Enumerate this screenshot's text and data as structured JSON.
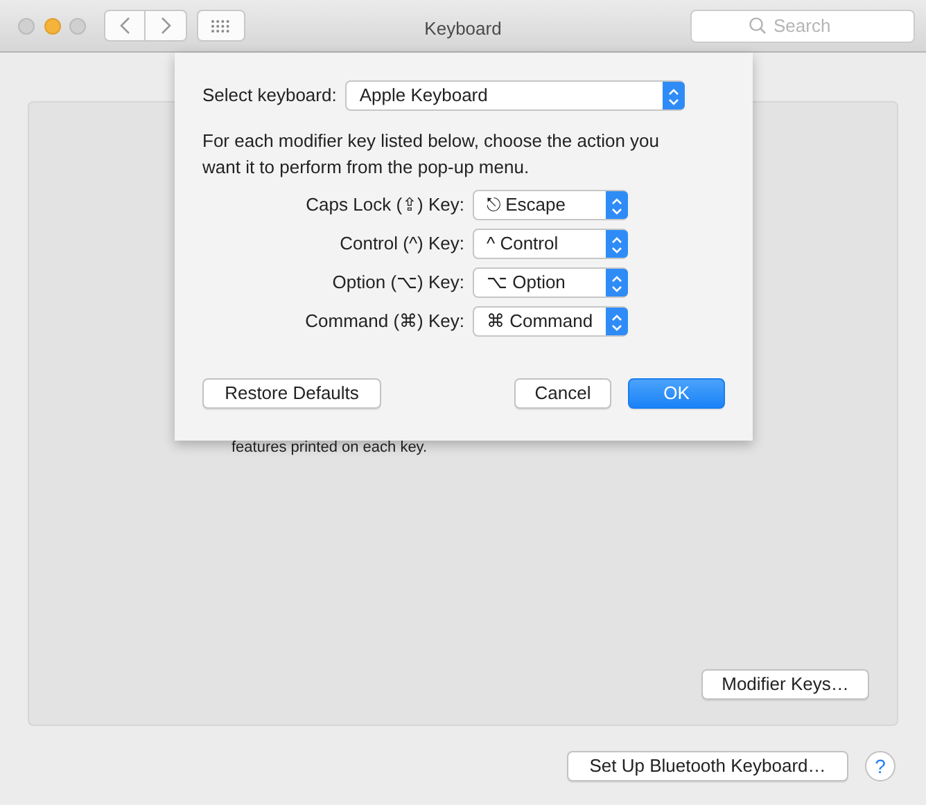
{
  "window": {
    "title": "Keyboard"
  },
  "search": {
    "placeholder": "Search"
  },
  "background": {
    "partial_text": "features printed on each key.",
    "buttons": [
      "Modifier Keys…"
    ]
  },
  "footer": {
    "button": "Set Up Bluetooth Keyboard…",
    "help": "?"
  },
  "sheet": {
    "keyboard_label": "Select keyboard:",
    "keyboard_value": "Apple Keyboard",
    "instructions": "For each modifier key listed below, choose the action you want it to perform from the pop-up menu.",
    "modifiers": [
      {
        "label": "Caps Lock (⇪) Key:",
        "value": "⎋ Escape"
      },
      {
        "label": "Control (^) Key:",
        "value": "^ Control"
      },
      {
        "label": "Option (⌥) Key:",
        "value": "⌥ Option"
      },
      {
        "label": "Command (⌘) Key:",
        "value": "⌘ Command"
      }
    ],
    "buttons": [
      {
        "label": "Restore Defaults",
        "kind": "normal"
      },
      {
        "label": "Cancel",
        "kind": "normal"
      },
      {
        "label": "OK",
        "kind": "default"
      }
    ]
  }
}
